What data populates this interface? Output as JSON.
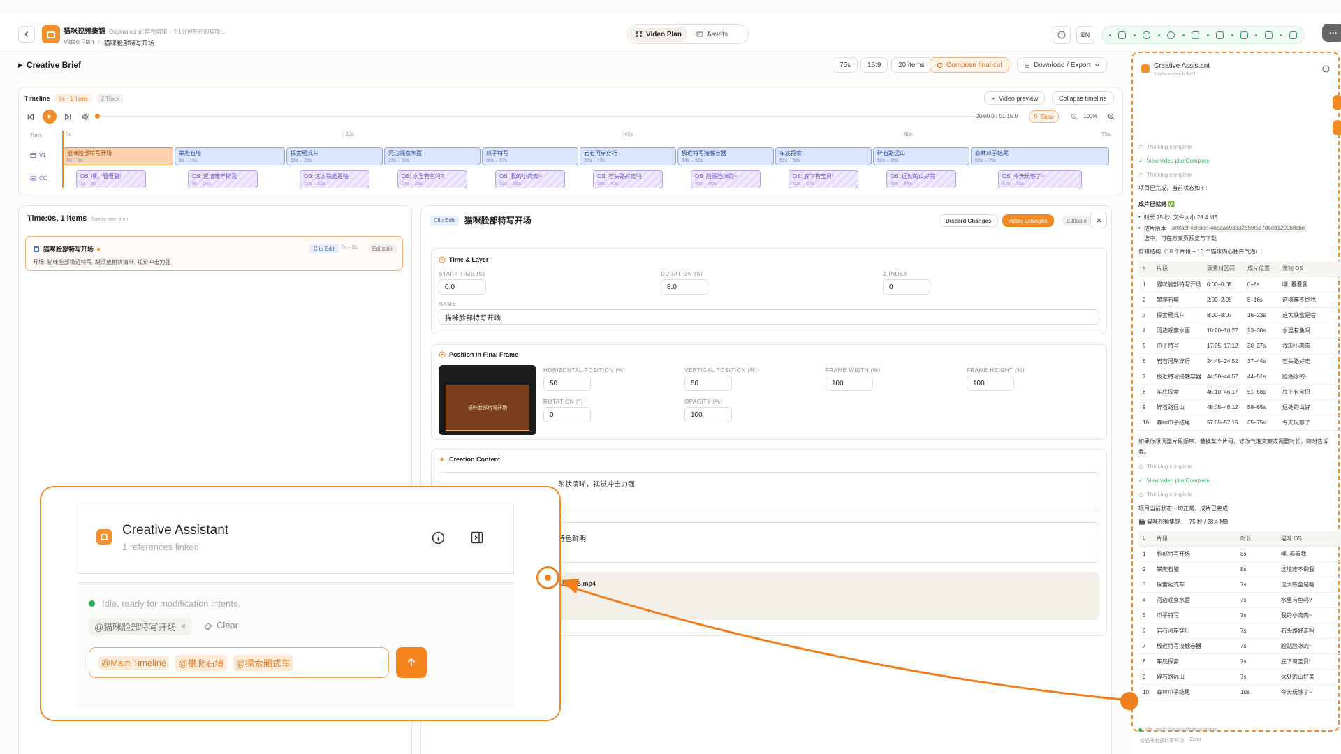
{
  "header": {
    "app_title": "猫咪视频集锦",
    "subtitle": "Original script:帮我剪辑一个1分钟左右的猫咪...",
    "breadcrumb_root": "Video Plan",
    "breadcrumb_sep": "/",
    "breadcrumb_current": "猫咪脸部特写开场",
    "tabs": [
      {
        "label": "Video Plan"
      },
      {
        "label": "Assets"
      }
    ],
    "lang": "EN",
    "more_label": "···"
  },
  "brief": {
    "title": "Creative Brief",
    "duration": "75s",
    "ratio": "16:9",
    "items": "20 items",
    "compose": "Compose final cut",
    "download": "Download / Export"
  },
  "timeline": {
    "label": "Timeline",
    "range_badge": "0s · 1 items",
    "tracks_badge": "2 Track",
    "video_preview": "Video preview",
    "collapse": "Collapse timeline",
    "time": "00:00.0 / 01:15.0",
    "snap": "Snap",
    "zoom": "100%",
    "ruler_label": "Track",
    "ticks": [
      "0s",
      "20s",
      "40s",
      "60s",
      "75s"
    ],
    "v1_label": "V1",
    "cc_label": "CC",
    "total_seconds": 75,
    "clips": [
      {
        "name": "猫咪脸部特写开场",
        "range": "0s – 8s",
        "start": 0,
        "end": 8
      },
      {
        "name": "攀爬石墙",
        "range": "8s – 16s",
        "start": 8,
        "end": 16
      },
      {
        "name": "探索厢式车",
        "range": "16s – 23s",
        "start": 16,
        "end": 23
      },
      {
        "name": "河边观察水面",
        "range": "23s – 30s",
        "start": 23,
        "end": 30
      },
      {
        "name": "爪子特写",
        "range": "30s – 37s",
        "start": 30,
        "end": 37
      },
      {
        "name": "岩石河岸穿行",
        "range": "37s – 44s",
        "start": 37,
        "end": 44
      },
      {
        "name": "极近特写接触容器",
        "range": "44s – 51s",
        "start": 44,
        "end": 51
      },
      {
        "name": "车底探索",
        "range": "51s – 58s",
        "start": 51,
        "end": 58
      },
      {
        "name": "碎石路远山",
        "range": "58s – 65s",
        "start": 58,
        "end": 65
      },
      {
        "name": "森林爪子结尾",
        "range": "65s – 75s",
        "start": 65,
        "end": 75
      }
    ],
    "captions": [
      {
        "text": "OS: 嘿，看看我!",
        "range": "1s – 8s",
        "start": 1,
        "end": 6
      },
      {
        "text": "OS: 这墙难不倒我",
        "range": "9s – 14s",
        "start": 9,
        "end": 14
      },
      {
        "text": "OS: 这大铁盒是啥",
        "range": "17s – 22s",
        "start": 17,
        "end": 22
      },
      {
        "text": "OS: 水里有鱼吗?",
        "range": "24s – 29s",
        "start": 24,
        "end": 29
      },
      {
        "text": "OS: 我的小肉肉~",
        "range": "31s – 36s",
        "start": 31,
        "end": 36
      },
      {
        "text": "OS: 石头路好走吗",
        "range": "38s – 43s",
        "start": 38,
        "end": 43
      },
      {
        "text": "OS: 脸贴脸冰的~",
        "range": "45s – 50s",
        "start": 45,
        "end": 50
      },
      {
        "text": "OS: 底下有宝贝!",
        "range": "52s – 57s",
        "start": 52,
        "end": 57
      },
      {
        "text": "OS: 远处的山好美",
        "range": "59s – 64s",
        "start": 59,
        "end": 64
      },
      {
        "text": "OS: 今天玩够了~",
        "range": "67s – 73s",
        "start": 67,
        "end": 73
      }
    ]
  },
  "list": {
    "title": "Time:0s, 1 items",
    "sort": "Sort by start time",
    "item_name": "猫咪脸部特写开场",
    "item_tag": "Clip Edit",
    "item_range": "0s – 8s",
    "item_state": "Editable",
    "item_desc": "开场: 猫咪脸部极近特写, 胡须放射状清晰, 视觉冲击力强"
  },
  "editor": {
    "tag": "Clip Edit",
    "title": "猫咪脸部特写开场",
    "discard": "Discard Changes",
    "apply": "Apply Changes",
    "state": "Editable",
    "time_layer": {
      "title": "Time & Layer",
      "start_label": "START TIME (S)",
      "start_value": "0.0",
      "duration_label": "DURATION (S)",
      "duration_value": "8.0",
      "z_label": "Z-INDEX",
      "z_value": "0",
      "name_label": "NAME",
      "name_value": "猫咪脸部特写开场"
    },
    "position": {
      "title": "Position in Final Frame",
      "preview_text": "猫咪脸部特写开场",
      "h_label": "HORIZONTAL POSITION (%)",
      "h_value": "50",
      "v_label": "VERTICAL POSITION (%)",
      "v_value": "50",
      "w_label": "FRAME WIDTH (%)",
      "w_value": "100",
      "fh_label": "FRAME HEIGHT (%)",
      "fh_value": "100",
      "rot_label": "ROTATION (°)",
      "rot_value": "0",
      "op_label": "OPACITY (%)",
      "op_value": "100"
    },
    "content": {
      "title": "Creation Content",
      "line1": "射状清晰，视觉冲击力强",
      "line2": "特色鲜明",
      "file": "_250MB.mp4"
    }
  },
  "assistant": {
    "title": "Creative Assistant",
    "refs": "1 references linked",
    "thinking": "Thinking complete",
    "view_plan": "View video planComplete",
    "msg1": "项目已完成，当前状态如下:",
    "ready": "成片已就绪 ✅",
    "bullet1": "时长 75 秒, 文件大小 28.4 MB",
    "bullet2_prefix": "成片版本",
    "bullet2_code": "artifact-version-46bdae93a32659f5b7d6e81209b8cbe",
    "bullet2_suffix": "选中，可在方案页预览与下载",
    "structure": "剪辑结构（10 个片段 + 10 个猫咪内心独白气泡）:",
    "table1_headers": [
      "#",
      "片段",
      "源素材区间",
      "成片位置",
      "宠物 OS"
    ],
    "table1_rows": [
      [
        "1",
        "猫咪脸部特写开场",
        "0:00–0:08",
        "0–8s",
        "嘿, 看看我"
      ],
      [
        "2",
        "攀爬石墙",
        "2:00–2:08",
        "8–16s",
        "这墙难不倒我"
      ],
      [
        "3",
        "探索厢式车",
        "8:00–8:07",
        "16–23s",
        "这大铁盒是啥"
      ],
      [
        "4",
        "河边观察水面",
        "10:20–10:27",
        "23–30s",
        "水里有鱼吗"
      ],
      [
        "5",
        "爪子特写",
        "17:05–17:12",
        "30–37s",
        "我的小肉肉"
      ],
      [
        "6",
        "岩石河岸穿行",
        "24:45–24:52",
        "37–44s",
        "石头路好走"
      ],
      [
        "7",
        "极近特写接触容器",
        "44:50–44:57",
        "44–51s",
        "脸贴冰的~"
      ],
      [
        "8",
        "车底探索",
        "46:10–46:17",
        "51–58s",
        "底下有宝贝"
      ],
      [
        "9",
        "碎石路远山",
        "48:05–48:12",
        "58–65s",
        "远处的山好"
      ],
      [
        "10",
        "森林爪子结尾",
        "57:05–57:15",
        "65–75s",
        "今天玩够了"
      ]
    ],
    "followup": "如果你想调整片段顺序、替换某个片段、修改气泡文案或调整时长，随时告诉我。",
    "msg2": "项目当前状态一切正常，成片已完成:",
    "summary": "🎬 猫咪视频集锦 — 75 秒 / 28.4 MB",
    "table2_headers": [
      "#",
      "片段",
      "时长",
      "猫咪 OS"
    ],
    "table2_rows": [
      [
        "1",
        "脸部特写开场",
        "8s",
        "嘿, 看看我!"
      ],
      [
        "2",
        "攀爬石墙",
        "8s",
        "这墙难不倒我"
      ],
      [
        "3",
        "探索厢式车",
        "7s",
        "这大铁盒是啥"
      ],
      [
        "4",
        "河边观察水面",
        "7s",
        "水里有鱼吗?"
      ],
      [
        "5",
        "爪子特写",
        "7s",
        "我的小肉肉~"
      ],
      [
        "6",
        "岩石河岸穿行",
        "7s",
        "石头路好走吗"
      ],
      [
        "7",
        "极近特写接触容器",
        "7s",
        "脸贴脸冰的~"
      ],
      [
        "8",
        "车底探索",
        "7s",
        "底下有宝贝!"
      ],
      [
        "9",
        "碎石路远山",
        "7s",
        "远处的山好美"
      ],
      [
        "10",
        "森林爪子结尾",
        "10s",
        "今天玩够了~"
      ]
    ],
    "idle": "Idle, ready for modification intents.",
    "chip": "@猫咪脸部特写开场",
    "clear": "Clear"
  },
  "zoom": {
    "title": "Creative Assistant",
    "refs": "1 references linked",
    "idle": "Idle, ready for modification intents.",
    "chip": "@猫咪脸部特写开场",
    "chip_close": "×",
    "clear": "Clear",
    "input_mentions": [
      "@Main Timeline",
      "@攀爬石墙",
      "@探索厢式车"
    ]
  },
  "colors": {
    "accent": "#f08a24",
    "status_green": "#22b35a"
  }
}
